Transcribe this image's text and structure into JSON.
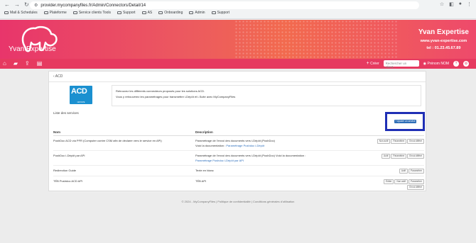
{
  "browser": {
    "url": "provider.mycompanyfiles.fr/Admin/Connectors/Detail/14",
    "bookmarks": [
      "Mail & Schedules",
      "Plateforme",
      "Service clients Tools",
      "Support",
      "AS",
      "Onboarding",
      "Admin",
      "Support"
    ]
  },
  "banner": {
    "brand": "Yvan Expertise",
    "contact_name": "Yvan Expertise",
    "website": "www.yvan-expertise.com",
    "phone": "tel : 01.23.45.67.89"
  },
  "toolbar": {
    "create_label": "Créer",
    "search_placeholder": "Rechercher un client...",
    "user_name": "Prénom NOM"
  },
  "page": {
    "breadcrumb": "ACD",
    "logo_text": "ACD",
    "logo_subtext": "GROUPE",
    "intro_line1": "Retrouvez les différents connecteurs proposés pour les solutions ACD.",
    "intro_line2": "Vous y retrouverez les paramétrages pour transmettre i-Dépôt et i-Suite avec MyCompanyFiles",
    "list_label": "Liste des services",
    "add_service": "+ Ajouter un service",
    "columns": {
      "name": "Nom",
      "description": "Description"
    },
    "rows": [
      {
        "name": "PushDoc ACD via PFR (Computer contre CSM afin de déclarer vers le service en API)",
        "desc1": "Paramétrage de l'envoi des documents vers i-Dépôt (PushDoc)",
        "desc2": "Voici la documentation :",
        "desc_link": "Paramétrage Pushdoc i-Dépôt",
        "actions": [
          "Non actif",
          "Paramétrer",
          "Envoi différé"
        ]
      },
      {
        "name": "PushDoc i-Dépôt par API",
        "desc1": "Paramétrage de l'envoi des documents vers i-Dépôt (PushDoc) Voici la documentation :",
        "desc2": "",
        "desc_link": "Paramétrage Pushdoc i-Dépôt par API",
        "actions": [
          "Actif",
          "Paramétrer",
          "Envoi différé"
        ]
      },
      {
        "name": "Redirection Guide",
        "desc1": "Texte en blanc",
        "desc2": "",
        "desc_link": "",
        "actions": [
          "Actif",
          "Paramétrer"
        ]
      },
      {
        "name": "TÉB Pushdoc ACD API",
        "desc1": "TÉB API",
        "desc2": "",
        "desc_link": "",
        "actions": [
          "Éditer",
          "Non actif",
          "Paramétrer",
          "Envoi différé"
        ]
      }
    ]
  },
  "footer": "© 2024 - MyCompanyFiles | Politique de confidentialité | Conditions générales d'utilisation"
}
